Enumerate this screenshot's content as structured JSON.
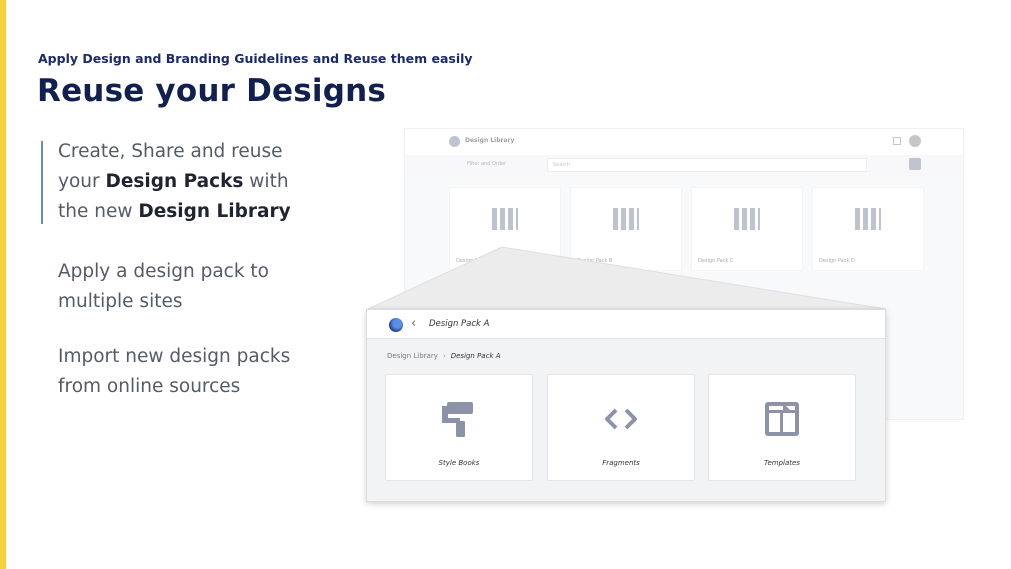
{
  "header": {
    "subtitle": "Apply Design and Branding Guidelines and Reuse them easily",
    "title": "Reuse your Designs"
  },
  "bullets": {
    "b1_part1": "Create, Share and reuse your ",
    "b1_bold1": "Design Packs",
    "b1_part2": " with the new ",
    "b1_bold2": "Design Library",
    "b2": "Apply a design pack to multiple sites",
    "b3": "Import new design packs from online sources"
  },
  "background_screen": {
    "app_title": "Design Library",
    "filter_label": "Filter and Order",
    "search_placeholder": "Search",
    "cards": [
      "Design Pack A",
      "Design Pack B",
      "Design Pack C",
      "Design Pack D"
    ]
  },
  "popup": {
    "title": "Design Pack A",
    "breadcrumb_root": "Design Library",
    "breadcrumb_current": "Design Pack A",
    "tiles": [
      {
        "label": "Style Books",
        "icon": "paint-roller-icon"
      },
      {
        "label": "Fragments",
        "icon": "code-brackets-icon"
      },
      {
        "label": "Templates",
        "icon": "template-layout-icon"
      }
    ]
  },
  "colors": {
    "accent_yellow": "#f5d23a",
    "title_navy": "#12204f",
    "icon_gray": "#8c93a8"
  }
}
